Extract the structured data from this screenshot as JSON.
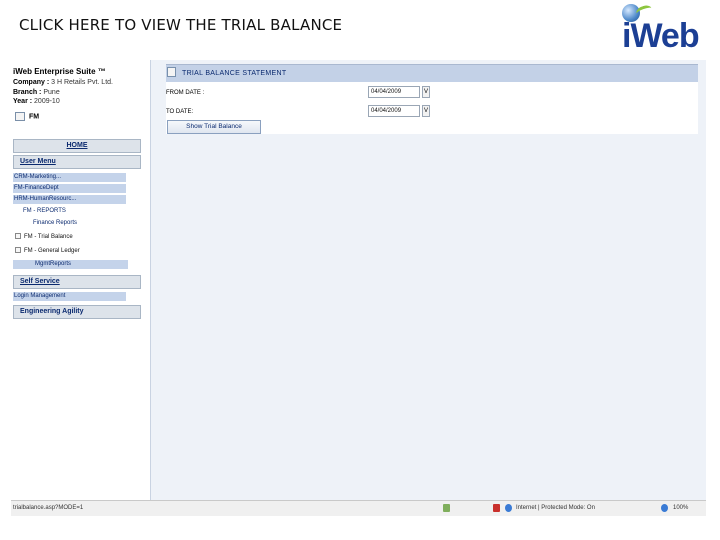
{
  "slide": {
    "title": "CLICK HERE TO VIEW THE TRIAL BALANCE"
  },
  "logo": {
    "word": "iWeb"
  },
  "sidebar": {
    "app_name": "iWeb Enterprise Suite ™",
    "company_label": "Company :",
    "company_value": "3 H Retails Pvt. Ltd.",
    "branch_label": "Branch :",
    "branch_value": "Pune",
    "year_label": "Year :",
    "year_value": "2009-10",
    "module": "FM",
    "home": "HOME",
    "user_menu": "User Menu",
    "links": [
      "CRM-Marketing...",
      "FM-FinanceDept",
      "HRM-HumanResourc..."
    ],
    "subitems": [
      "FM - REPORTS",
      "Finance Reports"
    ],
    "tree": [
      "FM - Trial Balance",
      "FM - General Ledger"
    ],
    "mgmt_reports": "MgmtReports",
    "self_service": "Self Service",
    "login_management": "Login Management",
    "engineering_agility": "Engineering Agility"
  },
  "main": {
    "header_title": "TRIAL BALANCE STATEMENT",
    "from_label": "FROM DATE :",
    "from_value": "04/04/2009",
    "to_label": "TO DATE:",
    "to_value": "04/04/2009",
    "cal_glyph": "V",
    "show_button": "Show Trial Balance"
  },
  "status_bar": {
    "url": "trialbalance.asp?MODE=1",
    "zone": "Internet | Protected Mode: On",
    "zoom": "100%"
  },
  "colors": {
    "accent": "#c3d1e7",
    "link_row": "#c4d3ea",
    "logo_blue": "#1c3f94"
  }
}
